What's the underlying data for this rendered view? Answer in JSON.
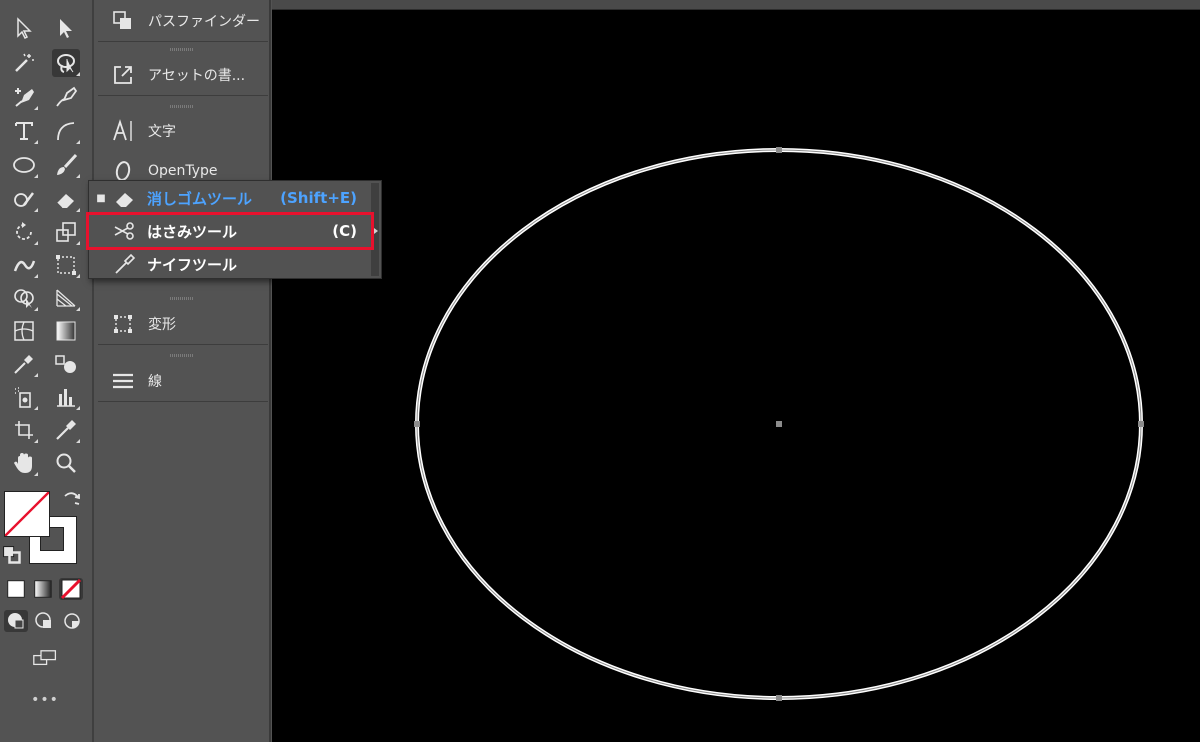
{
  "toolbar": {
    "tools": [
      {
        "name": "selection-tool-icon"
      },
      {
        "name": "direct-selection-tool-icon"
      },
      {
        "name": "magic-wand-tool-icon"
      },
      {
        "name": "lasso-tool-icon"
      },
      {
        "name": "pen-tool-icon"
      },
      {
        "name": "curvature-tool-icon"
      },
      {
        "name": "type-tool-icon"
      },
      {
        "name": "arc-tool-icon"
      },
      {
        "name": "ellipse-tool-icon"
      },
      {
        "name": "paintbrush-tool-icon"
      },
      {
        "name": "shaper-tool-icon"
      },
      {
        "name": "eraser-tool-icon"
      }
    ],
    "more_label": "•••"
  },
  "dock": {
    "items": [
      {
        "label": "パスファインダー",
        "icon": "pathfinder-icon"
      },
      {
        "label": "アセットの書...",
        "icon": "asset-export-icon"
      },
      {
        "label": "文字",
        "icon": "character-icon"
      },
      {
        "label": "OpenType",
        "icon": "opentype-icon"
      },
      {
        "label": "変形",
        "icon": "transform-icon"
      },
      {
        "label": "線",
        "icon": "stroke-icon"
      }
    ]
  },
  "flyout": {
    "items": [
      {
        "label": "消しゴムツール",
        "shortcut": "(Shift+E)",
        "icon": "eraser-icon",
        "selected": true
      },
      {
        "label": "はさみツール",
        "shortcut": "(C)",
        "icon": "scissors-icon",
        "highlighted": true
      },
      {
        "label": "ナイフツール",
        "shortcut": "",
        "icon": "knife-icon"
      }
    ],
    "highlight_color": "#e8112d",
    "selected_color": "#4da3ff"
  },
  "colors": {
    "canvas": "#000000",
    "ellipse_stroke": "#ffffff",
    "ui_background": "#535353"
  }
}
